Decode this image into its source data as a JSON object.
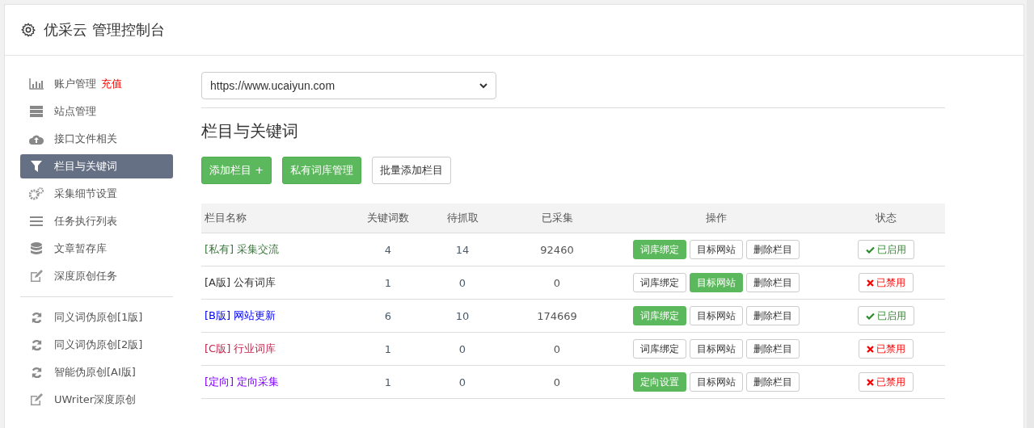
{
  "header": {
    "title": "优采云 管理控制台"
  },
  "sidebar": {
    "items": [
      {
        "label": "账户管理",
        "badge": "充值",
        "selected": false
      },
      {
        "label": "站点管理",
        "selected": false
      },
      {
        "label": "接口文件相关",
        "selected": false
      },
      {
        "label": "栏目与关键词",
        "selected": true
      },
      {
        "label": "采集细节设置",
        "selected": false
      },
      {
        "label": "任务执行列表",
        "selected": false
      },
      {
        "label": "文章暂存库",
        "selected": false
      },
      {
        "label": "深度原创任务",
        "selected": false
      }
    ],
    "tools": [
      {
        "label": "同义词伪原创[1版]",
        "selected": false
      },
      {
        "label": "同义词伪原创[2版]",
        "selected": false
      },
      {
        "label": "智能伪原创[AI版]",
        "selected": false
      },
      {
        "label": "UWriter深度原创",
        "selected": false
      }
    ]
  },
  "site_select": {
    "value": "https://www.ucaiyun.com"
  },
  "section_title": "栏目与关键词",
  "toolbar": [
    {
      "label": "添加栏目 +",
      "kind": "primary"
    },
    {
      "label": "私有词库管理",
      "kind": "primary"
    },
    {
      "label": "批量添加栏目",
      "kind": "default"
    }
  ],
  "table": {
    "columns": [
      "栏目名称",
      "关键词数",
      "待抓取",
      "已采集",
      "操作",
      "状态"
    ],
    "rows": [
      {
        "tag": "[私有]",
        "name": "采集交流",
        "color": "#3c763d",
        "keywords": "4",
        "pending": "14",
        "collected": "92460",
        "actions": [
          {
            "label": "词库绑定",
            "active": true
          },
          {
            "label": "目标网站",
            "active": false
          },
          {
            "label": "删除栏目",
            "active": false
          }
        ],
        "status": "已启用",
        "enabled": true
      },
      {
        "tag": "[A版]",
        "name": "公有词库",
        "color": "#333333",
        "keywords": "1",
        "pending": "0",
        "collected": "0",
        "actions": [
          {
            "label": "词库绑定",
            "active": false
          },
          {
            "label": "目标网站",
            "active": true
          },
          {
            "label": "删除栏目",
            "active": false
          }
        ],
        "status": "已禁用",
        "enabled": false
      },
      {
        "tag": "[B版]",
        "name": "网站更新",
        "color": "#0000ff",
        "keywords": "6",
        "pending": "10",
        "collected": "174669",
        "actions": [
          {
            "label": "词库绑定",
            "active": true
          },
          {
            "label": "目标网站",
            "active": false
          },
          {
            "label": "删除栏目",
            "active": false
          }
        ],
        "status": "已启用",
        "enabled": true
      },
      {
        "tag": "[C版]",
        "name": "行业词库",
        "color": "#c7254e",
        "keywords": "1",
        "pending": "0",
        "collected": "0",
        "actions": [
          {
            "label": "词库绑定",
            "active": false
          },
          {
            "label": "目标网站",
            "active": false
          },
          {
            "label": "删除栏目",
            "active": false
          }
        ],
        "status": "已禁用",
        "enabled": false
      },
      {
        "tag": "[定向]",
        "name": "定向采集",
        "color": "#8000ff",
        "keywords": "1",
        "pending": "0",
        "collected": "0",
        "actions": [
          {
            "label": "定向设置",
            "active": true
          },
          {
            "label": "目标网站",
            "active": false
          },
          {
            "label": "删除栏目",
            "active": false
          }
        ],
        "status": "已禁用",
        "enabled": false
      }
    ]
  }
}
